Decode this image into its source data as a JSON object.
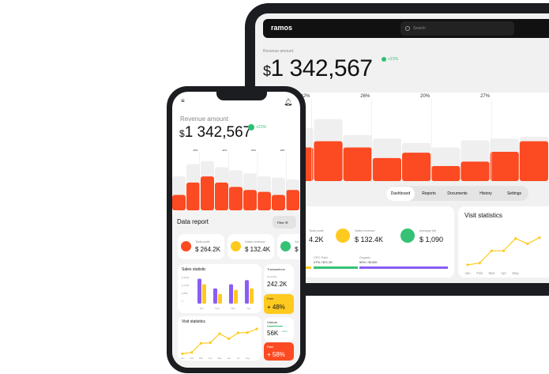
{
  "tablet": {
    "brand": "ramos",
    "search_placeholder": "Search",
    "revenue_label": "Revenue amount",
    "currency": "$",
    "revenue_value": "1 342,567",
    "change": "+21%",
    "bar_labels": [
      "42%",
      "26%",
      "20%",
      "27%"
    ],
    "tabs": [
      "Dashboard",
      "Reports",
      "Documents",
      "History",
      "Settings"
    ],
    "metrics": [
      {
        "label": "Total profit",
        "value": "4.2K"
      },
      {
        "label": "Sales revenue",
        "value": "$ 132.4K"
      },
      {
        "label": "Average bill",
        "value": "$ 1,090"
      }
    ],
    "channels": [
      {
        "label": "CPC Paid",
        "value": "27% / $71.2K"
      },
      {
        "label": "Organic",
        "value": "50% / $132K"
      }
    ],
    "partial_title": "c",
    "visit": {
      "title": "Visit statistics",
      "months": [
        "Jan",
        "Feb",
        "Mar",
        "Apr",
        "May"
      ],
      "values": [
        10,
        14,
        42,
        42,
        70,
        58,
        72
      ]
    }
  },
  "phone": {
    "revenue_label": "Revenue amount",
    "currency": "$",
    "revenue_value": "1 342,567",
    "change": "+21%",
    "bar_labels": [
      "28%",
      "42%",
      "26%",
      "20%"
    ],
    "report_title": "Data report",
    "filter": "Filter",
    "stats": [
      {
        "label": "Total profit",
        "value": "264.2K"
      },
      {
        "label": "Sales revenue",
        "value": "132.4K"
      },
      {
        "label": "Sa",
        "value": "$"
      }
    ],
    "sales": {
      "title": "Sales statistic",
      "yticks": [
        "$ 264K",
        "$ 176K",
        "$ 88K",
        "0"
      ],
      "months": [
        "Jan",
        "Feb",
        "Mar",
        "Apr"
      ],
      "purple": [
        90,
        55,
        70,
        85
      ],
      "yellow": [
        70,
        35,
        50,
        55
      ]
    },
    "transactions": {
      "label": "Transactions",
      "sub": "6 months",
      "value": "242.2K"
    },
    "rate1": {
      "label": "Rate",
      "value": "+ 48%"
    },
    "visit": {
      "title": "Visit statistics",
      "months": [
        "Jan",
        "Feb",
        "Mar",
        "Apr",
        "May",
        "Jun",
        "Jul",
        "Aug"
      ],
      "values": [
        5,
        10,
        45,
        47,
        82,
        62,
        85,
        86,
        100
      ]
    },
    "visitors": {
      "label": "Visitors",
      "value": "56K",
      "badge": "+10%"
    },
    "rate2": {
      "label": "Rate",
      "value": "+ 58%"
    }
  },
  "colors": {
    "orange": "#fc4a22",
    "yellow": "#ffca1f",
    "green": "#35c275",
    "purple": "#8a5cf5"
  }
}
